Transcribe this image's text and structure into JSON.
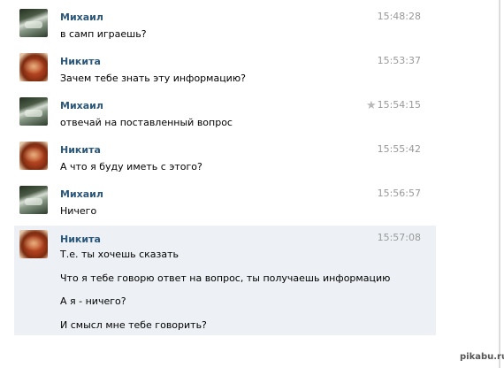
{
  "messages": [
    {
      "sender": "Михаил",
      "time": "15:48:28",
      "lines": [
        "в самп играешь?"
      ]
    },
    {
      "sender": "Никита",
      "time": "15:53:37",
      "lines": [
        "Зачем тебе знать эту информацию?"
      ]
    },
    {
      "sender": "Михаил",
      "time": "15:54:15",
      "lines": [
        "отвечай на поставленный вопрос"
      ],
      "starred": true
    },
    {
      "sender": "Никита",
      "time": "15:55:42",
      "lines": [
        "А что я буду иметь с этого?"
      ]
    },
    {
      "sender": "Михаил",
      "time": "15:56:57",
      "lines": [
        "Ничего"
      ]
    },
    {
      "sender": "Никита",
      "time": "15:57:08",
      "lines": [
        "Т.е. ты хочешь сказать",
        "Что я тебе говорю ответ на вопрос, ты получаешь информацию",
        "А я - ничего?",
        "И смысл мне тебе говорить?"
      ],
      "highlighted": true
    }
  ],
  "icons": {
    "star": "star-icon"
  },
  "watermark": "pikabu.ru",
  "colors": {
    "name": "#2b587a",
    "time": "#999999",
    "highlight": "#edf1f5"
  }
}
